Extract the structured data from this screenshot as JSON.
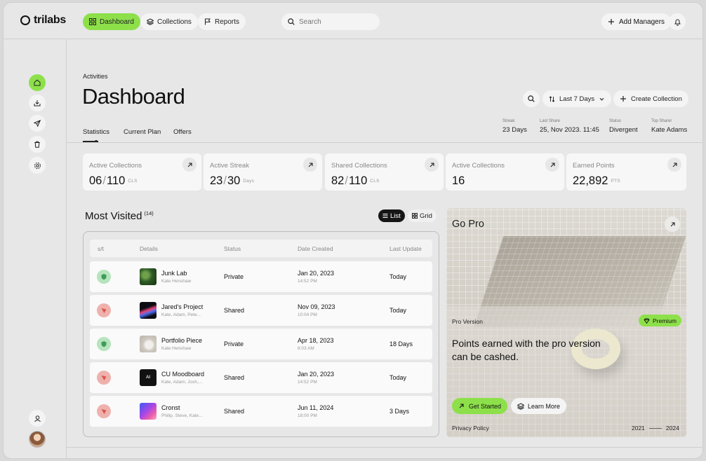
{
  "app": {
    "name": "trilabs"
  },
  "nav": {
    "dashboard": "Dashboard",
    "collections": "Collections",
    "reports": "Reports"
  },
  "search": {
    "placeholder": "Search"
  },
  "header": {
    "add_managers": "Add Managers"
  },
  "page": {
    "breadcrumb": "Activities",
    "title": "Dashboard"
  },
  "tabs": [
    "Statistics",
    "Current Plan",
    "Offers"
  ],
  "toolbar": {
    "range": "Last 7 Days",
    "create": "Create Collection"
  },
  "meta": [
    {
      "label": "Streak",
      "value": "23 Days"
    },
    {
      "label": "Last Share",
      "value": "25, Nov 2023. 11:45"
    },
    {
      "label": "Status",
      "value": "Divergent"
    },
    {
      "label": "Top Sharer",
      "value": "Kate Adams"
    }
  ],
  "stats": [
    {
      "label": "Active Collections",
      "value": "06",
      "total": "110",
      "unit": "CLS"
    },
    {
      "label": "Active Streak",
      "value": "23",
      "total": "30",
      "unit": "Days"
    },
    {
      "label": "Shared Collections",
      "value": "82",
      "total": "110",
      "unit": "CLS"
    },
    {
      "label": "Active Collections",
      "value": "16",
      "total": "",
      "unit": ""
    },
    {
      "label": "Earned Points",
      "value": "22,892",
      "total": "",
      "unit": "PTS"
    }
  ],
  "most_visited": {
    "title": "Most Visited",
    "count": "(14)",
    "view_list": "List",
    "view_grid": "Grid",
    "columns": [
      "s/t",
      "Details",
      "Status",
      "Date Created",
      "Last Update"
    ],
    "rows": [
      {
        "name": "Junk Lab",
        "people": "Kate  Henshaw",
        "status": "Private",
        "date": "Jan 20, 2023",
        "time": "14:52 PM",
        "last": "Today"
      },
      {
        "name": "Jared's Project",
        "people": "Kate, Adam, Pete...",
        "status": "Shared",
        "date": "Nov 09, 2023",
        "time": "10:04 PM",
        "last": "Today"
      },
      {
        "name": "Portfolio Piece",
        "people": "Kate  Henshaw",
        "status": "Private",
        "date": "Apr 18, 2023",
        "time": "8:03 AM",
        "last": "18 Days"
      },
      {
        "name": "CU Moodboard",
        "people": "Kate, Adam, Josh,...",
        "status": "Shared",
        "date": "Jan 20, 2023",
        "time": "14:52 PM",
        "last": "Today"
      },
      {
        "name": "Cronst",
        "people": "Philip, Steve, Kate...",
        "status": "Shared",
        "date": "Jun 11, 2024",
        "time": "18:00 PM",
        "last": "3 Days"
      }
    ]
  },
  "promo": {
    "title": "Go Pro",
    "version": "Pro Version",
    "badge": "Premium",
    "text": "Points earned with the pro version can be cashed.",
    "primary": "Get Started",
    "secondary": "Learn More",
    "privacy": "Privacy Policy",
    "year_start": "2021",
    "year_end": "2024"
  },
  "thumb_text": {
    "ai": "AI"
  }
}
